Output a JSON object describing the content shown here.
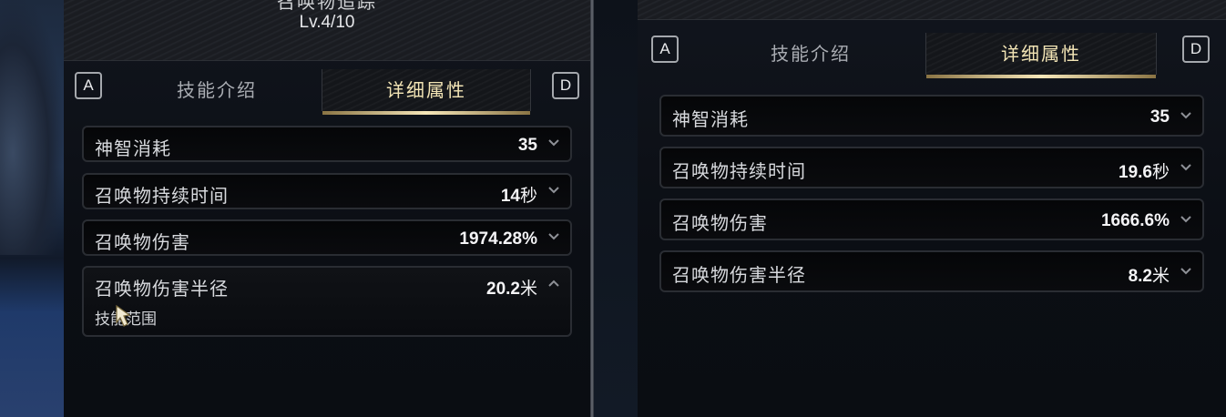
{
  "left_panel": {
    "skill_name": "召唤物追踪",
    "skill_level": "Lv.4/10",
    "tabs": {
      "key_left": "A",
      "key_right": "D",
      "intro_label": "技能介绍",
      "detail_label": "详细属性"
    },
    "stats": [
      {
        "label": "神智消耗",
        "value": "35",
        "unit": ""
      },
      {
        "label": "召唤物持续时间",
        "value": "14",
        "unit": "秒"
      },
      {
        "label": "召唤物伤害",
        "value": "1974.28%",
        "unit": ""
      },
      {
        "label": "召唤物伤害半径",
        "value": "20.2",
        "unit": "米",
        "expanded": true,
        "description": "技能范围"
      }
    ]
  },
  "right_panel": {
    "tabs": {
      "key_left": "A",
      "key_right": "D",
      "intro_label": "技能介绍",
      "detail_label": "详细属性"
    },
    "stats": [
      {
        "label": "神智消耗",
        "value": "35",
        "unit": ""
      },
      {
        "label": "召唤物持续时间",
        "value": "19.6",
        "unit": "秒"
      },
      {
        "label": "召唤物伤害",
        "value": "1666.6%",
        "unit": ""
      },
      {
        "label": "召唤物伤害半径",
        "value": "8.2",
        "unit": "米"
      }
    ]
  },
  "colors": {
    "active_tab_text": "#f2e4b5",
    "active_tab_underline": "#f6e7b9",
    "panel_bg": "#0b0e14"
  }
}
